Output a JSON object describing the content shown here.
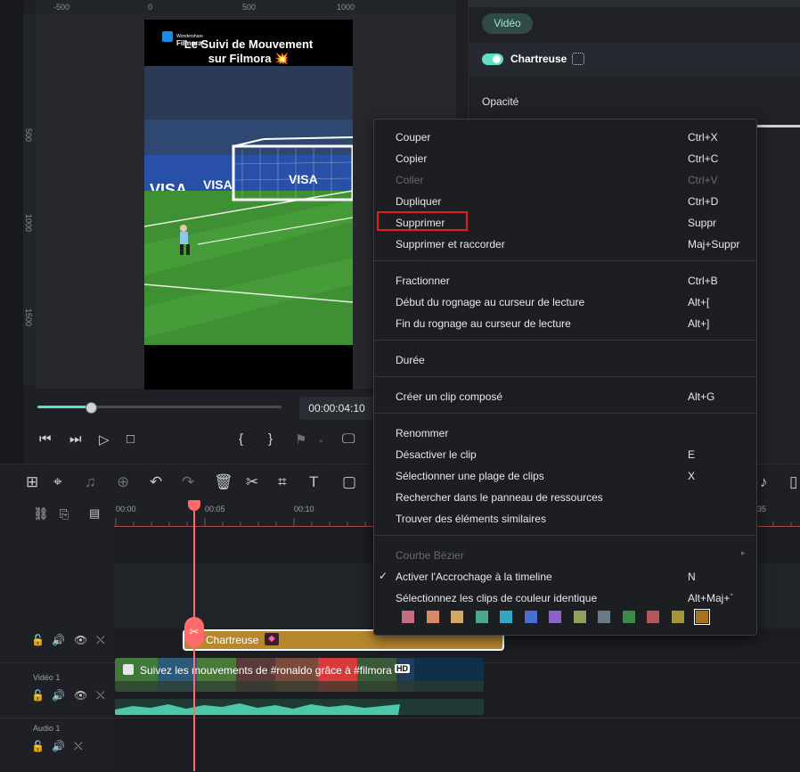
{
  "preview": {
    "ruler_top": [
      "-500",
      "0",
      "500",
      "1000"
    ],
    "ruler_left": [
      "500",
      "1000",
      "1500"
    ],
    "brand_line1": "Wondershare",
    "brand_line2": "Filmora",
    "title_line1": "Le Suivi de Mouvement",
    "title_line2": "sur Filmora 💥",
    "timecode": "00:00:04:10",
    "progress": 0.22
  },
  "inspector": {
    "tab": "Vidéo",
    "effect_name": "Chartreuse",
    "opacity_label": "Opacité"
  },
  "timeline": {
    "ruler_labels": [
      "00:00",
      "00:05",
      "00:10",
      "35"
    ],
    "filter_clip_label": "Chartreuse",
    "video_clip_title": "Suivez les mouvements de #ronaldo grâce à #filmora",
    "hd_badge": "HD",
    "track_labels": {
      "video": "Vidéo 1",
      "audio": "Audio 1"
    }
  },
  "context_menu": {
    "items": [
      {
        "label": "Couper",
        "shortcut": "Ctrl+X",
        "disabled": false
      },
      {
        "label": "Copier",
        "shortcut": "Ctrl+C",
        "disabled": false
      },
      {
        "label": "Coller",
        "shortcut": "Ctrl+V",
        "disabled": true
      },
      {
        "label": "Dupliquer",
        "shortcut": "Ctrl+D",
        "disabled": false
      },
      {
        "label": "Supprimer",
        "shortcut": "Suppr",
        "disabled": false
      },
      {
        "label": "Supprimer et raccorder",
        "shortcut": "Maj+Suppr",
        "disabled": false
      },
      {
        "label": "Fractionner",
        "shortcut": "Ctrl+B",
        "disabled": false
      },
      {
        "label": "Début du rognage au curseur de lecture",
        "shortcut": "Alt+[",
        "disabled": false
      },
      {
        "label": "Fin du rognage au curseur de lecture",
        "shortcut": "Alt+]",
        "disabled": false
      },
      {
        "label": "Durée",
        "shortcut": "",
        "disabled": false
      },
      {
        "label": "Créer un clip composé",
        "shortcut": "Alt+G",
        "disabled": false
      },
      {
        "label": "Renommer",
        "shortcut": "",
        "disabled": false
      },
      {
        "label": "Désactiver le clip",
        "shortcut": "E",
        "disabled": false
      },
      {
        "label": "Sélectionner une plage de clips",
        "shortcut": "X",
        "disabled": false
      },
      {
        "label": "Rechercher dans le panneau de ressources",
        "shortcut": "",
        "disabled": false
      },
      {
        "label": "Trouver des éléments similaires",
        "shortcut": "",
        "disabled": false
      },
      {
        "label": "Courbe Bézier",
        "shortcut": "",
        "disabled": true
      },
      {
        "label": "Activer l'Accrochage à la timeline",
        "shortcut": "N",
        "disabled": false
      },
      {
        "label": "Sélectionnez les clips de couleur identique",
        "shortcut": "Alt+Maj+`",
        "disabled": false
      }
    ],
    "color_swatches": [
      "#c86a82",
      "#d88a68",
      "#d2a866",
      "#4aa68e",
      "#2fa6c6",
      "#4a6ed8",
      "#8a62c8",
      "#8ea25e",
      "#6a7a88",
      "#3c8a4a",
      "#b2585a",
      "#a6963a",
      "#a8721e"
    ],
    "selected_swatch": "#a8721e",
    "highlight_color": "#e01f1f"
  },
  "colors": {
    "accent": "#5de0c4",
    "playhead": "#ff6b6b",
    "filter_clip": "#b7872e"
  }
}
